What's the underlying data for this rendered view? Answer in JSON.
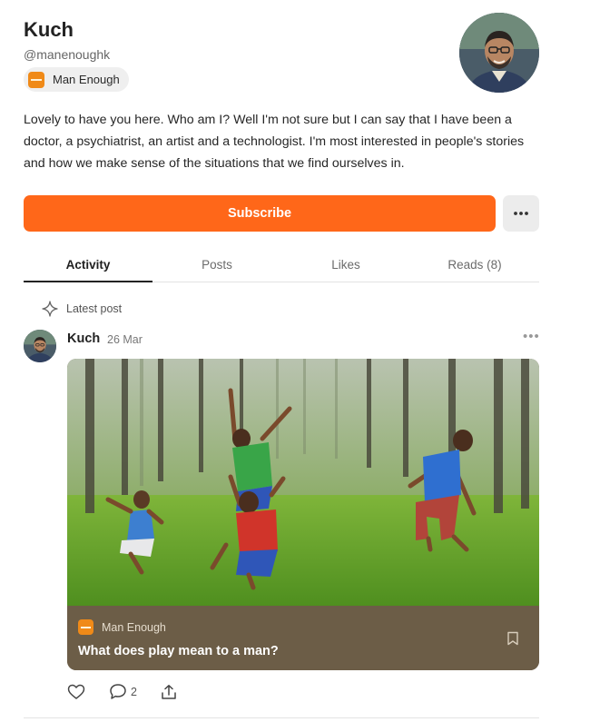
{
  "profile": {
    "name": "Kuch",
    "handle": "@manenoughk",
    "publication": "Man Enough",
    "bio": "Lovely to have you here. Who am I? Well I'm not sure but I can say that I have been a doctor, a psychiatrist, an artist and a technologist. I'm most interested in people's stories and how we make sense of the situations that we find ourselves in."
  },
  "actions": {
    "subscribe_label": "Subscribe",
    "more_label": "•••"
  },
  "tabs": [
    {
      "label": "Activity",
      "active": true
    },
    {
      "label": "Posts",
      "active": false
    },
    {
      "label": "Likes",
      "active": false
    },
    {
      "label": "Reads (8)",
      "active": false
    }
  ],
  "feed": {
    "section_label": "Latest post",
    "section_icon": "sparkle-icon",
    "post": {
      "author": "Kuch",
      "date": "26 Mar",
      "menu_label": "•••",
      "publication": "Man Enough",
      "title": "What does play mean to a man?",
      "comment_count": "2"
    }
  },
  "colors": {
    "accent": "#ff6719",
    "card_footer": "#6c5d47",
    "publication_logo": "#f08a18"
  },
  "icons": {
    "like": "heart-icon",
    "comment": "comment-icon",
    "share": "share-icon",
    "bookmark": "bookmark-icon"
  }
}
